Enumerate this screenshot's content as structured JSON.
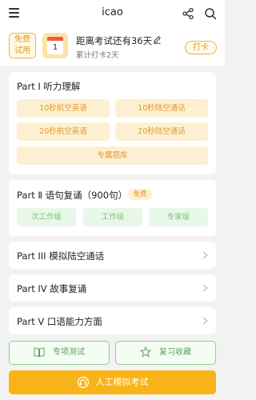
{
  "topbar": {
    "title": "icao",
    "menu_icon": "hamburger-menu-icon",
    "share_icon": "share-icon",
    "search_icon": "search-icon"
  },
  "header": {
    "free_tag": "免费\n试用",
    "free_tag_line1": "免费",
    "free_tag_line2": "试用",
    "calendar_day": "1",
    "countdown": "距离考试还有36天",
    "checkin_days": "累计打卡2天",
    "checkin_button": "打卡"
  },
  "parts": {
    "part1": {
      "title": "Part Ⅰ 听力理解",
      "items": [
        "10秒航空英语",
        "10秒陆空通话",
        "20秒航空英语",
        "20秒陆空通话",
        "专属题库"
      ]
    },
    "part2": {
      "title": "Part Ⅱ 语句复诵（900句）",
      "badge": "免费",
      "levels": [
        "次工作级",
        "工作级",
        "专家级"
      ]
    },
    "part3": {
      "title": "Part III 模拟陆空通话"
    },
    "part4": {
      "title": "Part IV 故事复诵"
    },
    "part5": {
      "title": "Part Ⅴ 口语能力方面"
    }
  },
  "bottom": {
    "special_test": "专项测试",
    "review": "复习收藏",
    "mock_exam": "人工模拟考试"
  },
  "colors": {
    "accent_orange": "#f8b418",
    "accent_green": "#5aa55a",
    "background": "#f2f2f2"
  }
}
